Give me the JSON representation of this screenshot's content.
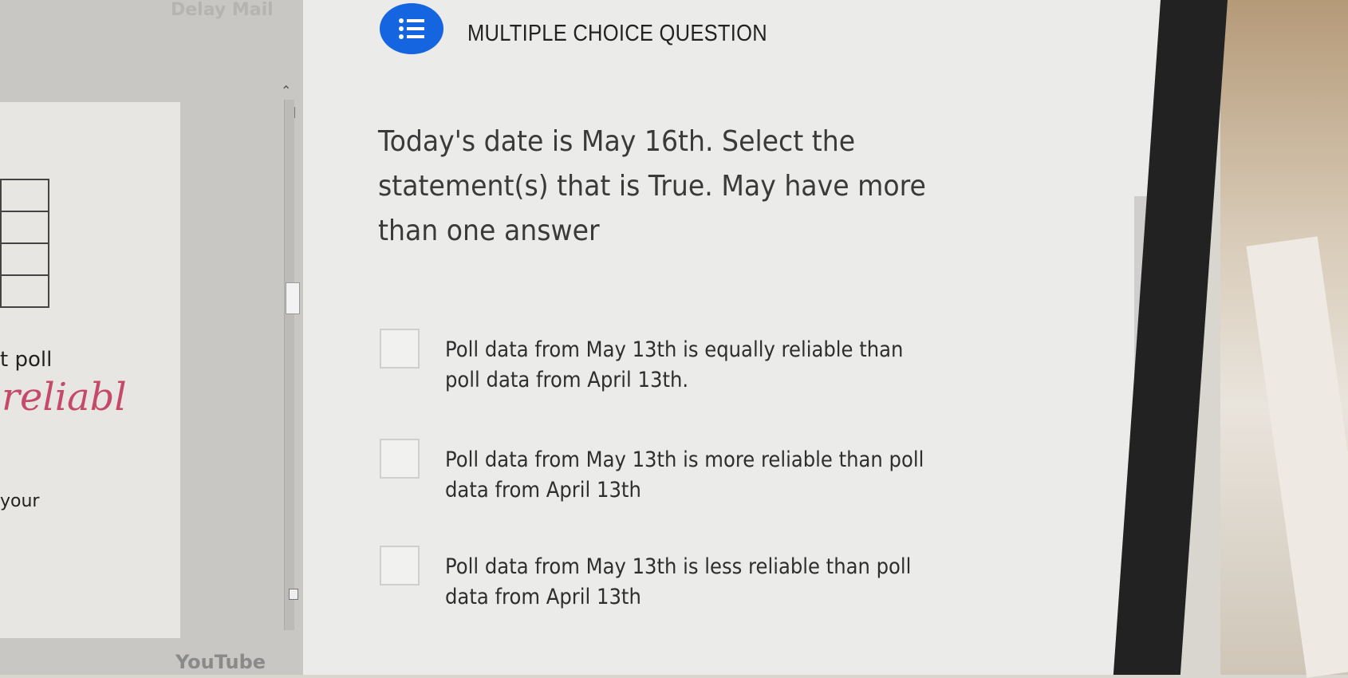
{
  "left_panel": {
    "top_label": "Delay Mail",
    "text_poll": "t poll",
    "handwriting_reliable": "reliabl",
    "text_your": "your",
    "bottom_bar": "YouTube"
  },
  "question": {
    "type_label": "MULTIPLE CHOICE QUESTION",
    "type_icon": "checklist-icon",
    "prompt": "Today's date is May 16th.  Select the statement(s) that is True.  May have more than one answer",
    "options": [
      {
        "label": "Poll data from May 13th is equally reliable than poll data from April 13th.",
        "checked": false
      },
      {
        "label": "Poll data from May 13th is more reliable than poll data from April 13th",
        "checked": false
      },
      {
        "label": "Poll data from May 13th is less reliable than poll data from April 13th",
        "checked": false
      }
    ]
  },
  "colors": {
    "accent": "#1565e0",
    "card_background": "#ebebea",
    "handwriting": "#c54a6a"
  }
}
